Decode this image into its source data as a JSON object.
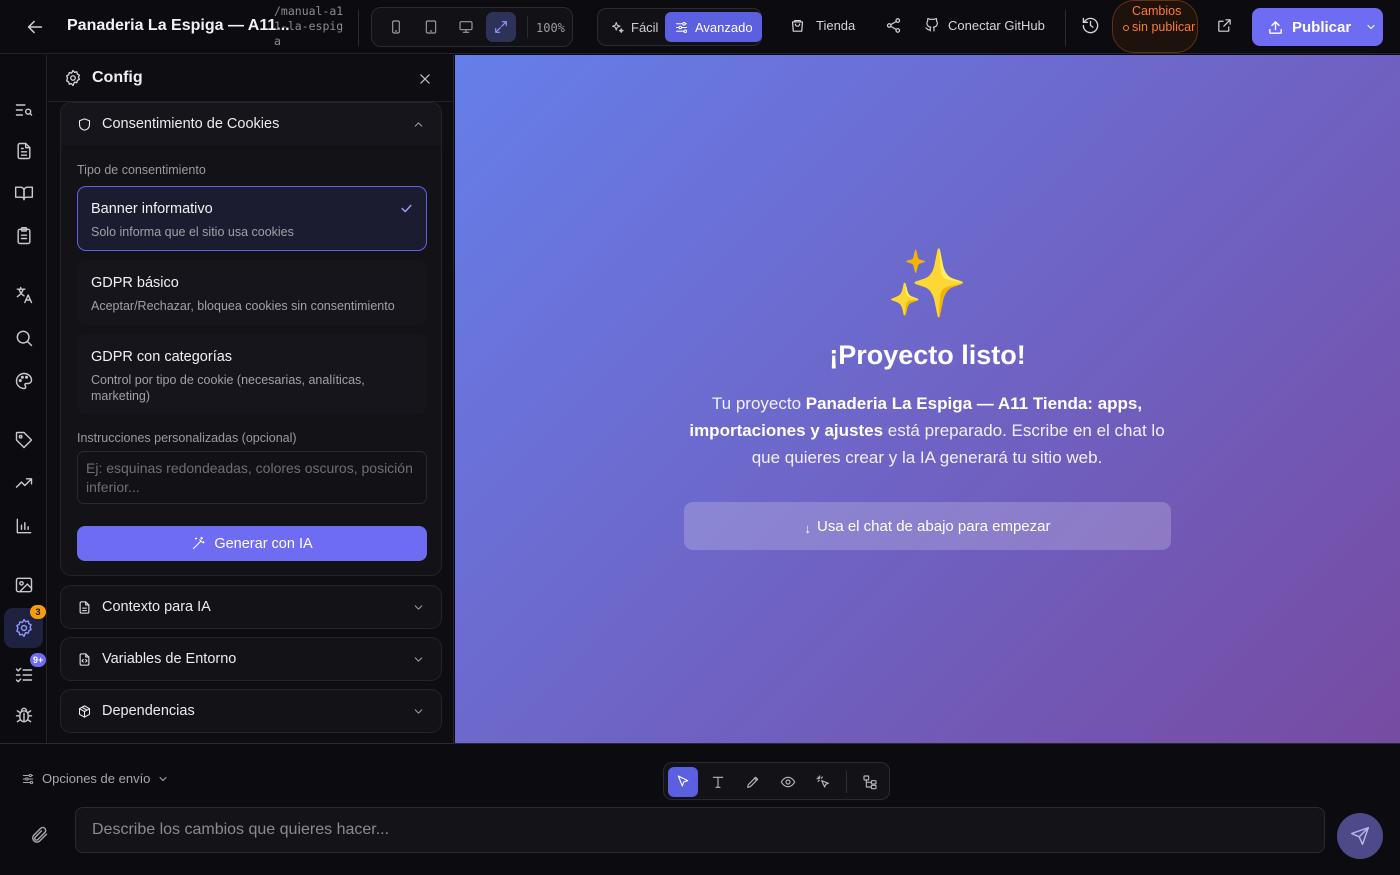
{
  "header": {
    "project_title": "Panaderia La Espiga — A11...",
    "project_slug": "/manual-a11-la-espiga",
    "zoom": "100%",
    "mode_easy": "Fácil",
    "mode_advanced": "Avanzado",
    "store": "Tienda",
    "github": "Conectar GitHub",
    "unsaved": "Cambios sin publicar",
    "publish": "Publicar"
  },
  "rail": {
    "settings_badge": "3",
    "tasks_badge": "9+"
  },
  "panel": {
    "title": "Config",
    "cookies": {
      "title": "Consentimiento de Cookies",
      "type_label": "Tipo de consentimiento",
      "options": [
        {
          "title": "Banner informativo",
          "desc": "Solo informa que el sitio usa cookies",
          "selected": true
        },
        {
          "title": "GDPR básico",
          "desc": "Aceptar/Rechazar, bloquea cookies sin consentimiento",
          "selected": false
        },
        {
          "title": "GDPR con categorías",
          "desc": "Control por tipo de cookie (necesarias, analíticas, marketing)",
          "selected": false
        }
      ],
      "instructions_label": "Instrucciones personalizadas (opcional)",
      "instructions_placeholder": "Ej: esquinas redondeadas, colores oscuros, posición inferior...",
      "generate": "Generar con IA"
    },
    "sections": {
      "ai_context": "Contexto para IA",
      "env_vars": "Variables de Entorno",
      "dependencies": "Dependencias"
    }
  },
  "preview": {
    "emoji": "✨",
    "title": "¡Proyecto listo!",
    "text_before": "Tu proyecto ",
    "text_bold": "Panaderia La Espiga — A11 Tienda: apps, importaciones y ajustes",
    "text_after": " está preparado. Escribe en el chat lo que quieres crear y la IA generará tu sitio web.",
    "cta_arrow": "↓",
    "cta": "Usa el chat de abajo para empezar"
  },
  "chat": {
    "send_options": "Opciones de envío",
    "placeholder": "Describe los cambios que quieres hacer..."
  },
  "colors": {
    "accent": "#6d6cf3",
    "warning": "#ff7a2e",
    "preview_gradient_start": "#667eea",
    "preview_gradient_end": "#764ba2"
  }
}
